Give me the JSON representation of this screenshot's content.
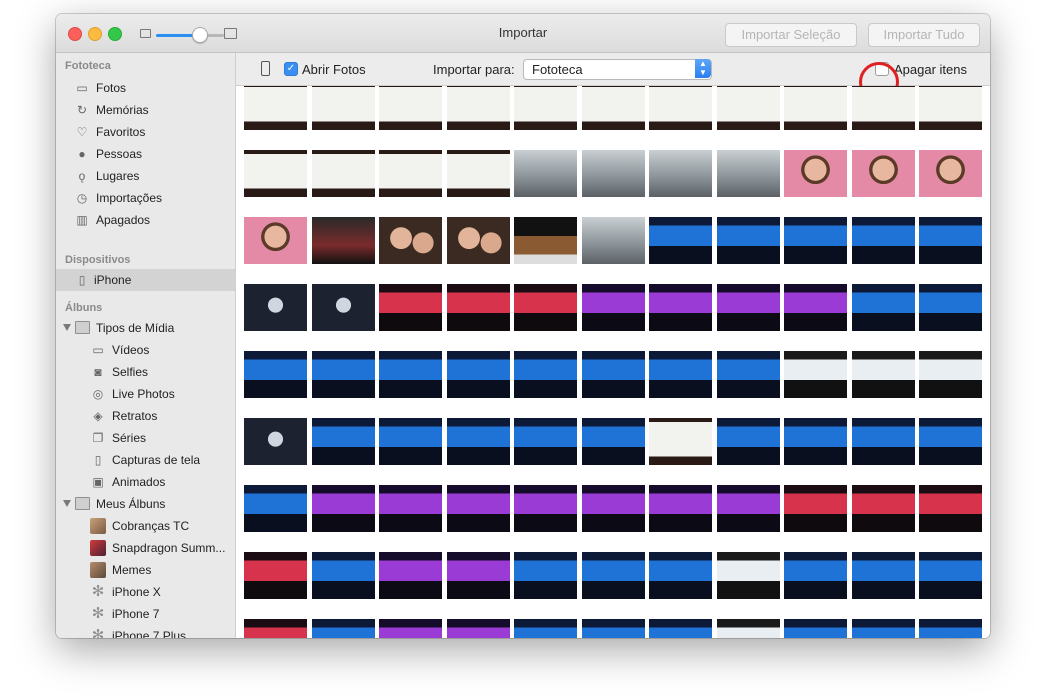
{
  "window": {
    "title": "Importar",
    "buttons": {
      "import_selection": "Importar Seleção",
      "import_all": "Importar Tudo"
    }
  },
  "sidebar": {
    "library_header": "Fototeca",
    "library_items": [
      {
        "label": "Fotos",
        "icon": "photos-icon"
      },
      {
        "label": "Memórias",
        "icon": "memories-icon"
      },
      {
        "label": "Favoritos",
        "icon": "heart-icon"
      },
      {
        "label": "Pessoas",
        "icon": "person-icon"
      },
      {
        "label": "Lugares",
        "icon": "pin-icon"
      },
      {
        "label": "Importações",
        "icon": "clock-icon"
      },
      {
        "label": "Apagados",
        "icon": "trash-icon"
      }
    ],
    "devices_header": "Dispositivos",
    "device_item": {
      "label": "iPhone",
      "icon": "iphone-icon",
      "selected": true
    },
    "albums_header": "Álbuns",
    "media_types": {
      "label": "Tipos de Mídia",
      "items": [
        {
          "label": "Vídeos",
          "icon": "video-icon"
        },
        {
          "label": "Selfies",
          "icon": "camera-icon"
        },
        {
          "label": "Live Photos",
          "icon": "live-photo-icon"
        },
        {
          "label": "Retratos",
          "icon": "cube-icon"
        },
        {
          "label": "Séries",
          "icon": "burst-icon"
        },
        {
          "label": "Capturas de tela",
          "icon": "screenshot-icon"
        },
        {
          "label": "Animados",
          "icon": "animated-icon"
        }
      ]
    },
    "my_albums": {
      "label": "Meus Álbuns",
      "items": [
        {
          "label": "Cobranças TC",
          "icon": "album-thumb-icon"
        },
        {
          "label": "Snapdragon Summ...",
          "icon": "album-thumb-icon"
        },
        {
          "label": "Memes",
          "icon": "album-thumb-icon"
        },
        {
          "label": "iPhone X",
          "icon": "gear-icon"
        },
        {
          "label": "iPhone 7",
          "icon": "gear-icon"
        },
        {
          "label": "iPhone 7 Plus",
          "icon": "gear-icon"
        }
      ]
    }
  },
  "toolbar": {
    "open_photos_label": "Abrir Fotos",
    "open_photos_checked": true,
    "import_to_label": "Importar para:",
    "import_to_value": "Fototeca",
    "delete_items_label": "Apagar itens",
    "delete_items_checked": false
  },
  "colors": {
    "accent": "#2b8ff2",
    "highlight_circle": "#e02020",
    "sidebar_bg": "#e9e9ea"
  },
  "photo_grid": {
    "columns": 11,
    "rows": [
      [
        "slide",
        "slide",
        "slide",
        "slide",
        "slide",
        "slide",
        "slide",
        "slide",
        "slide",
        "slide",
        "slide"
      ],
      [
        "slide",
        "slide",
        "slide",
        "slide",
        "city",
        "city",
        "city",
        "city",
        "selfie",
        "selfie",
        "selfie"
      ],
      [
        "selfie",
        "stage",
        "group",
        "group",
        "food",
        "city",
        "stage-blue",
        "stage-blue",
        "stage-blue",
        "stage-blue",
        "stage-blue"
      ],
      [
        "stage-dark",
        "stage-dark",
        "stage-red",
        "stage-red",
        "stage-red",
        "stage-purple",
        "stage-purple",
        "stage-purple",
        "stage-purple",
        "stage-blue",
        "stage-blue"
      ],
      [
        "stage-blue",
        "stage-blue",
        "stage-blue",
        "stage-blue",
        "stage-blue",
        "stage-blue",
        "stage-blue",
        "stage-blue",
        "stage-white",
        "stage-white",
        "stage-white"
      ],
      [
        "stage-dark",
        "stage-blue",
        "stage-blue",
        "stage-blue",
        "stage-blue",
        "stage-blue",
        "slide",
        "stage-blue",
        "stage-blue",
        "stage-blue",
        "stage-blue"
      ],
      [
        "stage-blue",
        "stage-purple",
        "stage-purple",
        "stage-purple",
        "stage-purple",
        "stage-purple",
        "stage-purple",
        "stage-purple",
        "stage-red",
        "stage-red",
        "stage-red"
      ],
      [
        "stage-red",
        "stage-blue",
        "stage-purple",
        "stage-purple",
        "stage-blue",
        "stage-blue",
        "stage-blue",
        "stage-white",
        "stage-blue",
        "stage-blue",
        "stage-blue"
      ],
      [
        "stage-red",
        "stage-blue",
        "stage-purple",
        "stage-purple",
        "stage-blue",
        "stage-blue",
        "stage-blue",
        "stage-white",
        "stage-blue",
        "stage-blue",
        "stage-blue"
      ]
    ]
  }
}
